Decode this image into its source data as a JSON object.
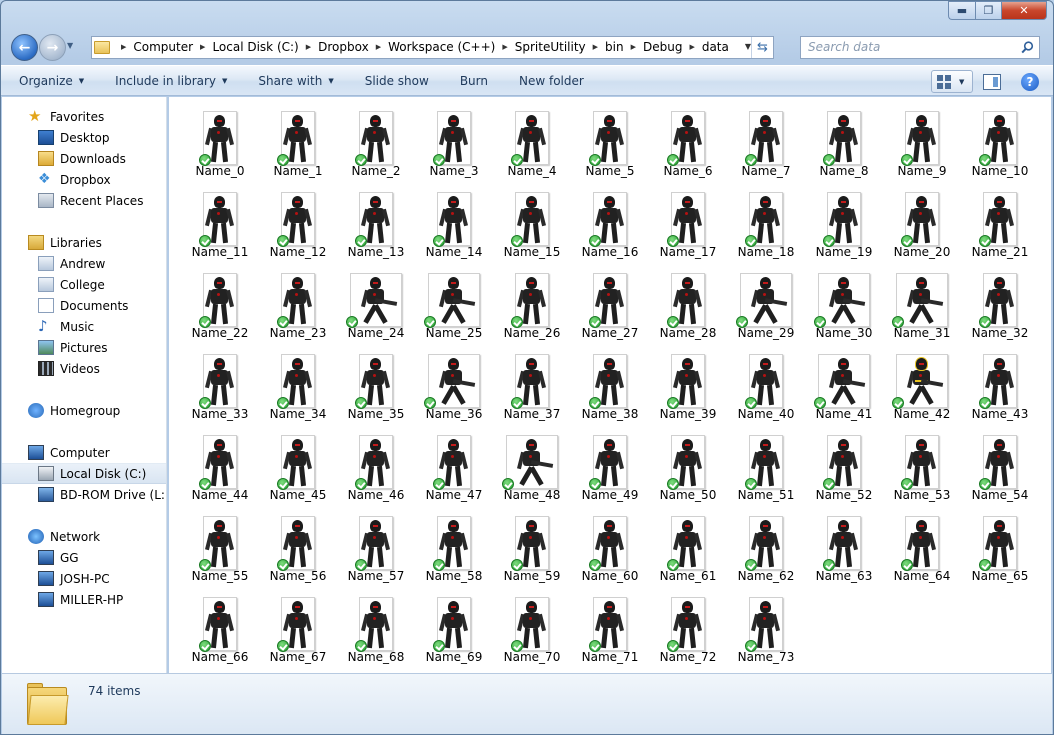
{
  "window": {
    "caption": {
      "minimize": "▬",
      "maximize": "❐",
      "close": "✕"
    }
  },
  "address": {
    "crumbs": [
      "Computer",
      "Local Disk (C:)",
      "Dropbox",
      "Workspace (C++)",
      "SpriteUtility",
      "bin",
      "Debug",
      "data"
    ]
  },
  "search": {
    "placeholder": "Search data"
  },
  "toolbar": {
    "organize": "Organize",
    "include_in_library": "Include in library",
    "share_with": "Share with",
    "slide_show": "Slide show",
    "burn": "Burn",
    "new_folder": "New folder",
    "help": "?"
  },
  "sidebar": {
    "favorites": {
      "label": "Favorites",
      "items": [
        "Desktop",
        "Downloads",
        "Dropbox",
        "Recent Places"
      ]
    },
    "libraries": {
      "label": "Libraries",
      "items": [
        "Andrew",
        "College",
        "Documents",
        "Music",
        "Pictures",
        "Videos"
      ]
    },
    "homegroup": {
      "label": "Homegroup"
    },
    "computer": {
      "label": "Computer",
      "items": [
        "Local Disk (C:)",
        "BD-ROM Drive (L:) H"
      ]
    },
    "network": {
      "label": "Network",
      "items": [
        "GG",
        "JOSH-PC",
        "MILLER-HP"
      ]
    }
  },
  "files": [
    "Name_0",
    "Name_1",
    "Name_2",
    "Name_3",
    "Name_4",
    "Name_5",
    "Name_6",
    "Name_7",
    "Name_8",
    "Name_9",
    "Name_10",
    "Name_11",
    "Name_12",
    "Name_13",
    "Name_14",
    "Name_15",
    "Name_16",
    "Name_17",
    "Name_18",
    "Name_19",
    "Name_20",
    "Name_21",
    "Name_22",
    "Name_23",
    "Name_24",
    "Name_25",
    "Name_26",
    "Name_27",
    "Name_28",
    "Name_29",
    "Name_30",
    "Name_31",
    "Name_32",
    "Name_33",
    "Name_34",
    "Name_35",
    "Name_36",
    "Name_37",
    "Name_38",
    "Name_39",
    "Name_40",
    "Name_41",
    "Name_42",
    "Name_43",
    "Name_44",
    "Name_45",
    "Name_46",
    "Name_47",
    "Name_48",
    "Name_49",
    "Name_50",
    "Name_51",
    "Name_52",
    "Name_53",
    "Name_54",
    "Name_55",
    "Name_56",
    "Name_57",
    "Name_58",
    "Name_59",
    "Name_60",
    "Name_61",
    "Name_62",
    "Name_63",
    "Name_64",
    "Name_65",
    "Name_66",
    "Name_67",
    "Name_68",
    "Name_69",
    "Name_70",
    "Name_71",
    "Name_72",
    "Name_73"
  ],
  "wide_thumbs": [
    "Name_24",
    "Name_25",
    "Name_29",
    "Name_30",
    "Name_31",
    "Name_36",
    "Name_41",
    "Name_42",
    "Name_48"
  ],
  "yellow_thumbs": [
    "Name_42"
  ],
  "status": {
    "items_count": "74 items"
  }
}
